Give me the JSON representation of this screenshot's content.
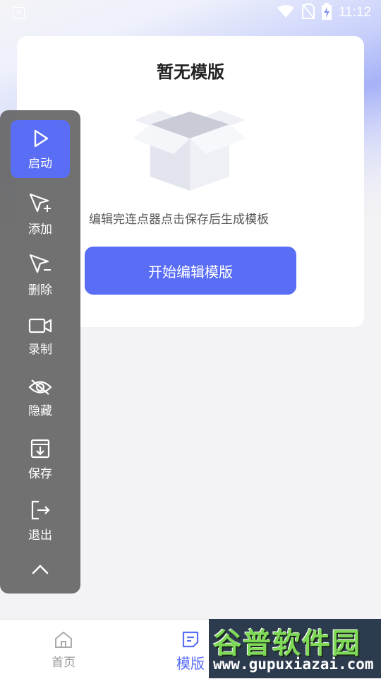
{
  "status_bar": {
    "badge": "A",
    "time": "11:12",
    "icons": [
      "wifi-icon",
      "no-sim-icon",
      "battery-charging-icon"
    ]
  },
  "card": {
    "title": "暂无模版",
    "description": "编辑完连点器点击保存后生成模板",
    "start_button": "开始编辑模版",
    "illustration": "empty-box-icon"
  },
  "float_panel": {
    "items": [
      {
        "label": "启动",
        "icon": "play-icon",
        "active": true
      },
      {
        "label": "添加",
        "icon": "cursor-add-icon"
      },
      {
        "label": "删除",
        "icon": "cursor-remove-icon"
      },
      {
        "label": "录制",
        "icon": "video-camera-icon"
      },
      {
        "label": "隐藏",
        "icon": "eye-off-icon"
      },
      {
        "label": "保存",
        "icon": "save-box-icon"
      },
      {
        "label": "退出",
        "icon": "exit-icon"
      }
    ],
    "collapse_icon": "chevron-up-icon"
  },
  "bottom_nav": {
    "items": [
      {
        "label": "首页",
        "icon": "home-icon",
        "active": false
      },
      {
        "label": "模版",
        "icon": "template-icon",
        "active": true
      }
    ],
    "active_color": "#5a6ef5",
    "inactive_color": "#999999"
  },
  "watermark": {
    "title": "谷普软件园",
    "url": "www.gupuxiazai.com"
  },
  "colors": {
    "accent": "#5a6ef5",
    "panel": "#666666"
  }
}
